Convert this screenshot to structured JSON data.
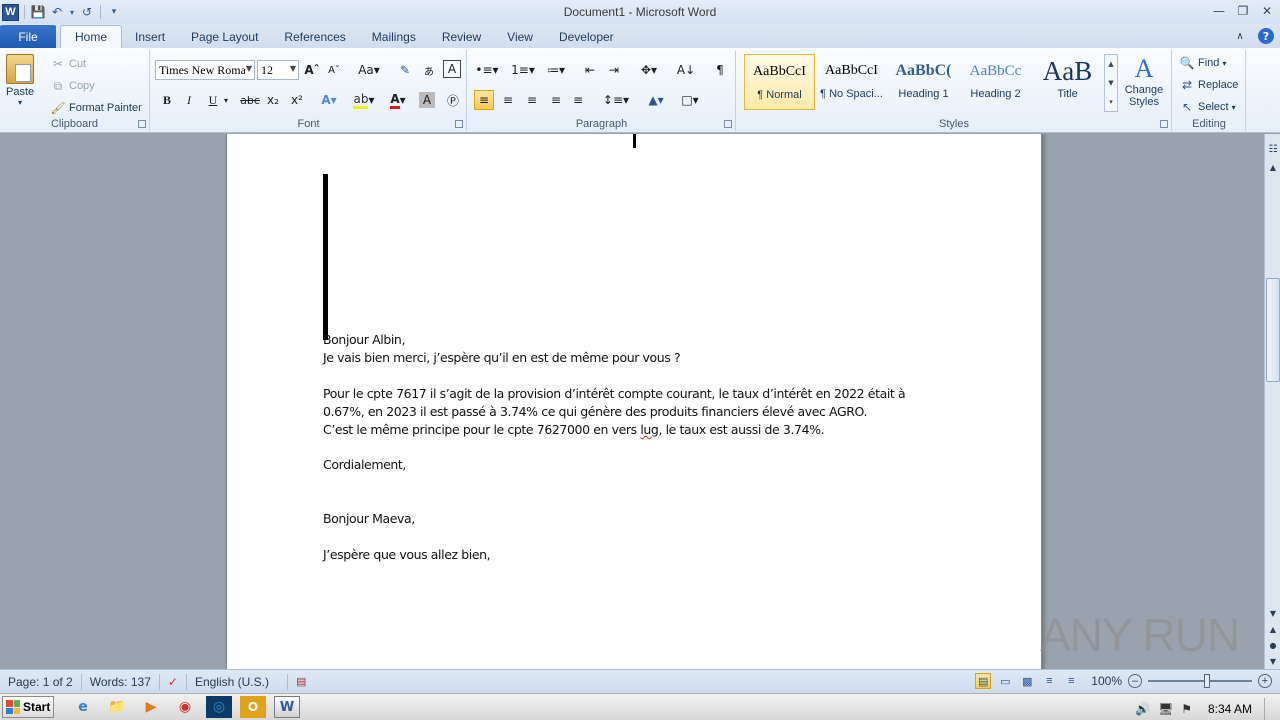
{
  "window": {
    "title": "Document1  -  Microsoft Word",
    "app_icon": "W"
  },
  "tabs": {
    "file": "File",
    "items": [
      "Home",
      "Insert",
      "Page Layout",
      "References",
      "Mailings",
      "Review",
      "View",
      "Developer"
    ],
    "active": "Home"
  },
  "ribbon": {
    "clipboard": {
      "label": "Clipboard",
      "paste": "Paste",
      "cut": "Cut",
      "copy": "Copy",
      "format_painter": "Format Painter"
    },
    "font": {
      "label": "Font",
      "font_name": "Times New Roma",
      "font_size": "12"
    },
    "paragraph": {
      "label": "Paragraph"
    },
    "styles": {
      "label": "Styles",
      "items": [
        {
          "sample": "AaBbCcI",
          "name": "¶ Normal"
        },
        {
          "sample": "AaBbCcI",
          "name": "¶ No Spaci..."
        },
        {
          "sample": "AaBbC(",
          "name": "Heading 1"
        },
        {
          "sample": "AaBbCc",
          "name": "Heading 2"
        },
        {
          "sample": "AaB",
          "name": "Title"
        }
      ],
      "change_styles": "Change Styles"
    },
    "editing": {
      "label": "Editing",
      "find": "Find",
      "replace": "Replace",
      "select": "Select"
    }
  },
  "document": {
    "lines": [
      "Bonjour Albin,",
      "Je vais bien merci, j’espère qu’il en est de même pour vous ?",
      "Pour le cpte 7617 il s’agit de la provision d’intérêt compte courant, le taux d’intérêt en 2022 était à",
      "0.67%, en 2023 il est passé à 3.74% ce qui génère des produits financiers élevé avec AGRO.",
      "Cordialement,",
      "Bonjour Maeva,",
      "J’espère que vous allez bien,"
    ],
    "line6_before": "C’est le même principe pour le cpte 7627000  en vers ",
    "line6_misspelled": "lug",
    "line6_after": ", le taux est aussi de 3.74%."
  },
  "statusbar": {
    "page": "Page: 1 of 2",
    "words": "Words: 137",
    "language": "English (U.S.)",
    "zoom": "100%"
  },
  "taskbar": {
    "start": "Start",
    "time": "8:34 AM"
  },
  "watermark": "ANY RUN"
}
